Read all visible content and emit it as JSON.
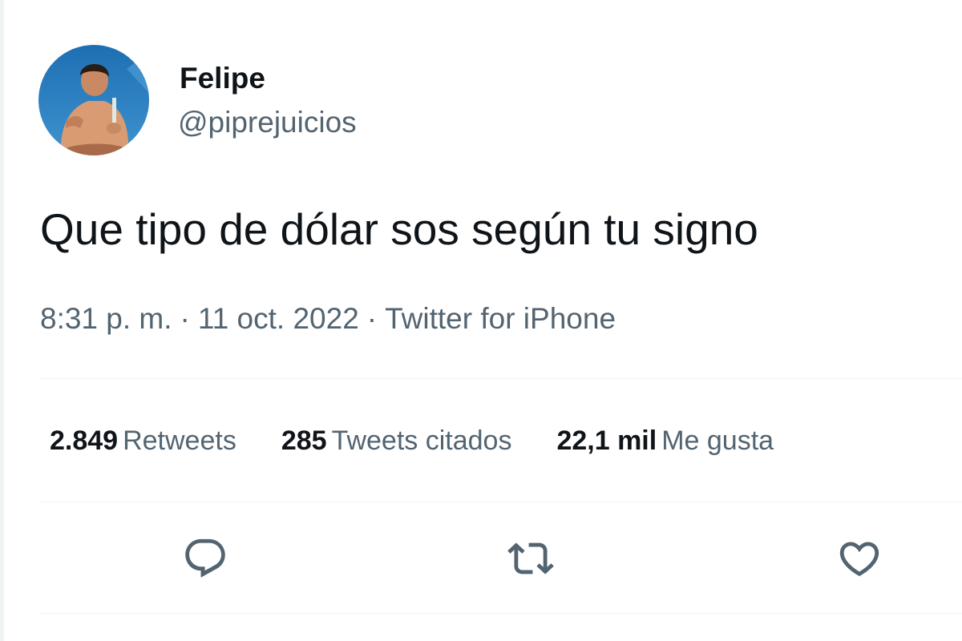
{
  "user": {
    "display_name": "Felipe",
    "handle": "@piprejuicios",
    "avatar_icon": "profile-photo-avatar"
  },
  "tweet": {
    "text": "Que tipo de dólar sos según tu signo",
    "time": "8:31 p. m.",
    "date": "11 oct. 2022",
    "source": "Twitter for iPhone",
    "separator": "·"
  },
  "stats": {
    "retweets": {
      "count": "2.849",
      "label": "Retweets"
    },
    "quotes": {
      "count": "285",
      "label": "Tweets citados"
    },
    "likes": {
      "count": "22,1 mil",
      "label": "Me gusta"
    }
  },
  "actions": {
    "reply_icon": "speech-bubble-icon",
    "retweet_icon": "retweet-icon",
    "like_icon": "heart-icon"
  },
  "colors": {
    "text_primary": "#0f1419",
    "text_secondary": "#536471",
    "divider": "#eff3f4"
  }
}
